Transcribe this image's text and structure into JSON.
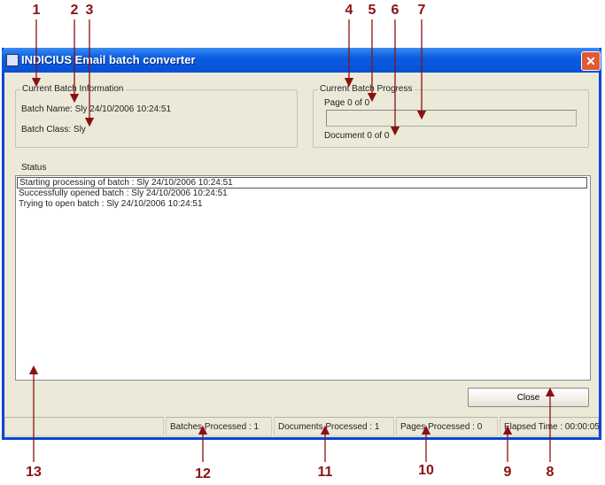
{
  "window": {
    "title": "INDICIUS Email batch converter",
    "close_glyph": "✕"
  },
  "batch_info": {
    "legend": "Current Batch Information",
    "name": "Batch Name: Sly 24/10/2006 10:24:51",
    "class": "Batch Class: Sly"
  },
  "batch_progress": {
    "legend": "Current Batch Progress",
    "page": "Page 0 of 0",
    "document": "Document 0 of 0",
    "progress_percent": 0
  },
  "status": {
    "label": "Status",
    "items": [
      "Starting processing of batch : Sly 24/10/2006 10:24:51",
      "Successfully opened batch : Sly 24/10/2006 10:24:51",
      "Trying to open batch : Sly 24/10/2006 10:24:51"
    ]
  },
  "buttons": {
    "close": "Close"
  },
  "statusbar": {
    "batches": "Batches Processed : 1",
    "documents": "Documents Processed : 1",
    "pages": "Pages Processed : 0",
    "elapsed": "Elapsed Time :   00:00:05"
  },
  "callouts": [
    "1",
    "2",
    "3",
    "4",
    "5",
    "6",
    "7",
    "8",
    "9",
    "10",
    "11",
    "12",
    "13"
  ],
  "colors": {
    "callout": "#8b1111",
    "titlebar": "#0a5ee0"
  }
}
